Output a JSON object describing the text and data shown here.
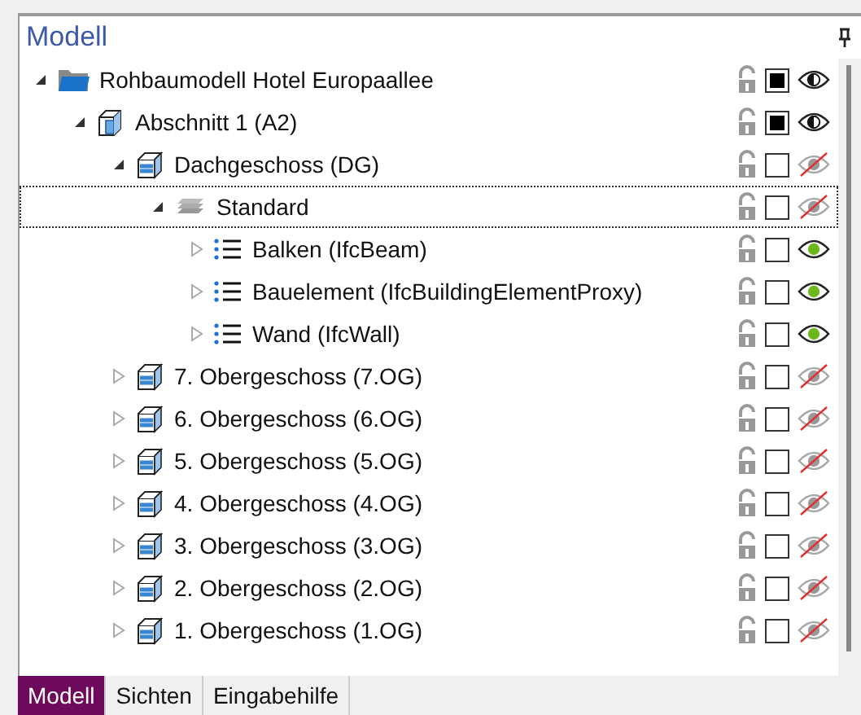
{
  "panel": {
    "title": "Modell"
  },
  "tree": [
    {
      "label": "Rohbaumodell Hotel Europaallee",
      "kind": "folder",
      "expanded": true,
      "selected": false,
      "partially_checked": true,
      "shown": false,
      "partially_shown": true,
      "children": [
        {
          "label": "Abschnitt 1 (A2)",
          "kind": "section",
          "expanded": true,
          "selected": false,
          "partially_checked": true,
          "shown": false,
          "partially_shown": true,
          "children": [
            {
              "label": "Dachgeschoss (DG)",
              "kind": "floor",
              "expanded": true,
              "selected": false,
              "partially_checked": false,
              "shown": false,
              "partially_shown": false,
              "children": [
                {
                  "label": "Standard",
                  "kind": "layer",
                  "expanded": true,
                  "selected": true,
                  "partially_checked": false,
                  "shown": false,
                  "partially_shown": false,
                  "children": [
                    {
                      "label": "Balken (IfcBeam)",
                      "kind": "category",
                      "expanded": false,
                      "selected": false,
                      "partially_checked": false,
                      "shown": true,
                      "partially_shown": false
                    },
                    {
                      "label": "Bauelement (IfcBuildingElementProxy)",
                      "kind": "category",
                      "expanded": false,
                      "selected": false,
                      "partially_checked": false,
                      "shown": true,
                      "partially_shown": false
                    },
                    {
                      "label": "Wand (IfcWall)",
                      "kind": "category",
                      "expanded": false,
                      "selected": false,
                      "partially_checked": false,
                      "shown": true,
                      "partially_shown": false
                    }
                  ]
                }
              ]
            },
            {
              "label": "7. Obergeschoss (7.OG)",
              "kind": "floor",
              "expanded": false,
              "selected": false,
              "partially_checked": false,
              "shown": false,
              "partially_shown": false
            },
            {
              "label": "6. Obergeschoss (6.OG)",
              "kind": "floor",
              "expanded": false,
              "selected": false,
              "partially_checked": false,
              "shown": false,
              "partially_shown": false
            },
            {
              "label": "5. Obergeschoss (5.OG)",
              "kind": "floor",
              "expanded": false,
              "selected": false,
              "partially_checked": false,
              "shown": false,
              "partially_shown": false
            },
            {
              "label": "4. Obergeschoss (4.OG)",
              "kind": "floor",
              "expanded": false,
              "selected": false,
              "partially_checked": false,
              "shown": false,
              "partially_shown": false
            },
            {
              "label": "3. Obergeschoss (3.OG)",
              "kind": "floor",
              "expanded": false,
              "selected": false,
              "partially_checked": false,
              "shown": false,
              "partially_shown": false
            },
            {
              "label": "2. Obergeschoss (2.OG)",
              "kind": "floor",
              "expanded": false,
              "selected": false,
              "partially_checked": false,
              "shown": false,
              "partially_shown": false
            },
            {
              "label": "1. Obergeschoss (1.OG)",
              "kind": "floor",
              "expanded": false,
              "selected": false,
              "partially_checked": false,
              "shown": false,
              "partially_shown": false
            }
          ]
        }
      ]
    }
  ],
  "tabs": [
    {
      "label": "Modell",
      "selected": true
    },
    {
      "label": "Sichten",
      "selected": false
    },
    {
      "label": "Eingabehilfe",
      "selected": false
    }
  ]
}
